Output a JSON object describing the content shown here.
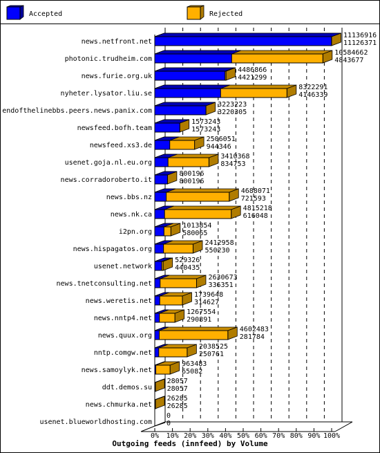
{
  "chart_data": {
    "type": "bar",
    "orientation": "horizontal",
    "style": "3d-overlapped",
    "title": "Outgoing feeds (innfeed) by Volume",
    "xlabel": "Outgoing feeds (innfeed) by Volume",
    "ylabel": "",
    "xlim": [
      0,
      100
    ],
    "x_unit": "% of max",
    "x_ticks": [
      "0%",
      "10%",
      "20%",
      "30%",
      "40%",
      "50%",
      "60%",
      "70%",
      "80%",
      "90%",
      "100%"
    ],
    "grid": true,
    "legend_position": "top",
    "max_value": 11136916,
    "categories": [
      "news.netfront.net",
      "photonic.trudheim.com",
      "news.furie.org.uk",
      "nyheter.lysator.liu.se",
      "endofthelinebbs.peers.news.panix.com",
      "newsfeed.bofh.team",
      "newsfeed.xs3.de",
      "usenet.goja.nl.eu.org",
      "news.corradoroberto.it",
      "news.bbs.nz",
      "news.nk.ca",
      "i2pn.org",
      "news.hispagatos.org",
      "usenet.network",
      "news.tnetconsulting.net",
      "news.weretis.net",
      "news.nntp4.net",
      "news.quux.org",
      "nntp.comgw.net",
      "news.samoylyk.net",
      "ddt.demos.su",
      "news.chmurka.net",
      "usenet.blueworldhosting.com"
    ],
    "series": [
      {
        "name": "Accepted",
        "color": "#0000ff",
        "values": [
          11126371,
          4843677,
          4421299,
          4146339,
          3220305,
          1573243,
          944346,
          834753,
          800196,
          721593,
          616048,
          580065,
          550230,
          440435,
          336351,
          314627,
          290891,
          281784,
          250761,
          65082,
          28057,
          26285,
          0
        ]
      },
      {
        "name": "Rejected",
        "color": "#ffb000",
        "values": [
          11136916,
          10584662,
          4486866,
          8322291,
          3223223,
          1573243,
          2506051,
          3410368,
          800196,
          4688071,
          4815218,
          1013854,
          2412958,
          529326,
          2630673,
          1739648,
          1267554,
          4602483,
          2038525,
          963483,
          28057,
          26285,
          0
        ]
      }
    ],
    "value_labels": [
      [
        "11136916",
        "11126371"
      ],
      [
        "10584662",
        "4843677"
      ],
      [
        "4486866",
        "4421299"
      ],
      [
        "8322291",
        "4146339"
      ],
      [
        "3223223",
        "3220305"
      ],
      [
        "1573243",
        "1573243"
      ],
      [
        "2506051",
        "944346"
      ],
      [
        "3410368",
        "834753"
      ],
      [
        "800196",
        "800196"
      ],
      [
        "4688071",
        "721593"
      ],
      [
        "4815218",
        "616048"
      ],
      [
        "1013854",
        "580065"
      ],
      [
        "2412958",
        "550230"
      ],
      [
        "529326",
        "440435"
      ],
      [
        "2630673",
        "336351"
      ],
      [
        "1739648",
        "314627"
      ],
      [
        "1267554",
        "290891"
      ],
      [
        "4602483",
        "281784"
      ],
      [
        "2038525",
        "250761"
      ],
      [
        "963483",
        "65082"
      ],
      [
        "28057",
        "28057"
      ],
      [
        "26285",
        "26285"
      ],
      [
        "0",
        "0"
      ]
    ]
  },
  "legend": {
    "items": [
      {
        "label": "Accepted",
        "color": "#0000ff",
        "side_color": "#00009c"
      },
      {
        "label": "Rejected",
        "color": "#ffb000",
        "side_color": "#b07c00"
      }
    ]
  },
  "colors": {
    "accepted_front": "#0000ff",
    "accepted_top": "#0000b4",
    "accepted_side": "#00009c",
    "rejected_front": "#ffb000",
    "rejected_top": "#c88c00",
    "rejected_side": "#b07c00"
  }
}
